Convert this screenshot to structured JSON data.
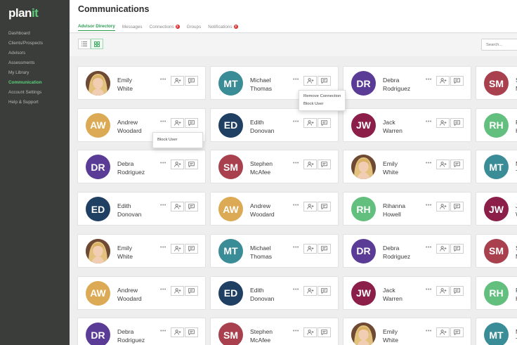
{
  "logo": {
    "text": "plan",
    "accent_text": "it"
  },
  "sidebar": {
    "items": [
      {
        "label": "Dashboard",
        "active": false
      },
      {
        "label": "Clients/Prospects",
        "active": false
      },
      {
        "label": "Advisors",
        "active": false
      },
      {
        "label": "Assessments",
        "active": false
      },
      {
        "label": "My Library",
        "active": false
      },
      {
        "label": "Communication",
        "active": true
      },
      {
        "label": "Account Settings",
        "active": false
      },
      {
        "label": "Help & Support",
        "active": false
      }
    ]
  },
  "header": {
    "title": "Communications",
    "tabs": [
      {
        "label": "Advisor Directory",
        "active": true,
        "badge": ""
      },
      {
        "label": "Messages",
        "active": false,
        "badge": ""
      },
      {
        "label": "Connections",
        "active": false,
        "badge": "2"
      },
      {
        "label": "Groups",
        "active": false,
        "badge": ""
      },
      {
        "label": "Notifications",
        "active": false,
        "badge": "3"
      }
    ]
  },
  "toolbar": {
    "search_placeholder": "Search...",
    "view_list_icon": "list-icon",
    "view_grid_icon": "grid-icon"
  },
  "colors": {
    "accent_green": "#5cd07a",
    "sidebar_bg": "#3a3d3a",
    "badge_red": "#e02b2b",
    "avatar_mt": "#3a8c96",
    "avatar_dr": "#5a3c96",
    "avatar_sm": "#a8404e",
    "avatar_aw": "#dcaa54",
    "avatar_ed": "#1f3f63",
    "avatar_jw": "#8b1f4a",
    "avatar_rh": "#62bf7d"
  },
  "cards": [
    [
      {
        "initials": "",
        "photo": true,
        "first": "Emily",
        "last": "White"
      },
      {
        "initials": "MT",
        "color": "#3a8c96",
        "first": "Michael",
        "last": "Thomas"
      },
      {
        "initials": "DR",
        "color": "#5a3c96",
        "first": "Debra",
        "last": "Rodriguez"
      },
      {
        "initials": "SM",
        "color": "#a8404e",
        "first": "S",
        "last": "M"
      }
    ],
    [
      {
        "initials": "AW",
        "color": "#dcaa54",
        "first": "Andrew",
        "last": "Woodard"
      },
      {
        "initials": "ED",
        "color": "#1f3f63",
        "first": "Edith",
        "last": "Donovan"
      },
      {
        "initials": "JW",
        "color": "#8b1f4a",
        "first": "Jack",
        "last": "Warren"
      },
      {
        "initials": "RH",
        "color": "#62bf7d",
        "first": "R",
        "last": "H"
      }
    ],
    [
      {
        "initials": "DR",
        "color": "#5a3c96",
        "first": "Debra",
        "last": "Rodriguez"
      },
      {
        "initials": "SM",
        "color": "#a8404e",
        "first": "Stephen",
        "last": "McAfee"
      },
      {
        "initials": "",
        "photo": true,
        "first": "Emily",
        "last": "White"
      },
      {
        "initials": "MT",
        "color": "#3a8c96",
        "first": "M",
        "last": "T"
      }
    ],
    [
      {
        "initials": "ED",
        "color": "#1f3f63",
        "first": "Edith",
        "last": "Donovan"
      },
      {
        "initials": "AW",
        "color": "#dcaa54",
        "first": "Andrew",
        "last": "Woodard"
      },
      {
        "initials": "RH",
        "color": "#62bf7d",
        "first": "Rihanna",
        "last": "Howell"
      },
      {
        "initials": "JW",
        "color": "#8b1f4a",
        "first": "J",
        "last": "W"
      }
    ],
    [
      {
        "initials": "",
        "photo": true,
        "first": "Emily",
        "last": "White"
      },
      {
        "initials": "MT",
        "color": "#3a8c96",
        "first": "Michael",
        "last": "Thomas"
      },
      {
        "initials": "DR",
        "color": "#5a3c96",
        "first": "Debra",
        "last": "Rodriguez"
      },
      {
        "initials": "SM",
        "color": "#a8404e",
        "first": "S",
        "last": "M"
      }
    ],
    [
      {
        "initials": "AW",
        "color": "#dcaa54",
        "first": "Andrew",
        "last": "Woodard"
      },
      {
        "initials": "ED",
        "color": "#1f3f63",
        "first": "Edith",
        "last": "Donovan"
      },
      {
        "initials": "JW",
        "color": "#8b1f4a",
        "first": "Jack",
        "last": "Warren"
      },
      {
        "initials": "RH",
        "color": "#62bf7d",
        "first": "R",
        "last": "H"
      }
    ],
    [
      {
        "initials": "DR",
        "color": "#5a3c96",
        "first": "Debra",
        "last": "Rodriguez"
      },
      {
        "initials": "SM",
        "color": "#a8404e",
        "first": "Stephen",
        "last": "McAfee"
      },
      {
        "initials": "",
        "photo": true,
        "first": "Emily",
        "last": "White"
      },
      {
        "initials": "MT",
        "color": "#3a8c96",
        "first": "M",
        "last": "T"
      }
    ]
  ],
  "menus": {
    "michael_menu": [
      "Remove Connection",
      "Block User"
    ],
    "andrew_menu": [
      "Block User"
    ]
  },
  "card_icons": {
    "more": "more-dots-icon",
    "add": "add-user-icon",
    "message": "message-icon"
  }
}
